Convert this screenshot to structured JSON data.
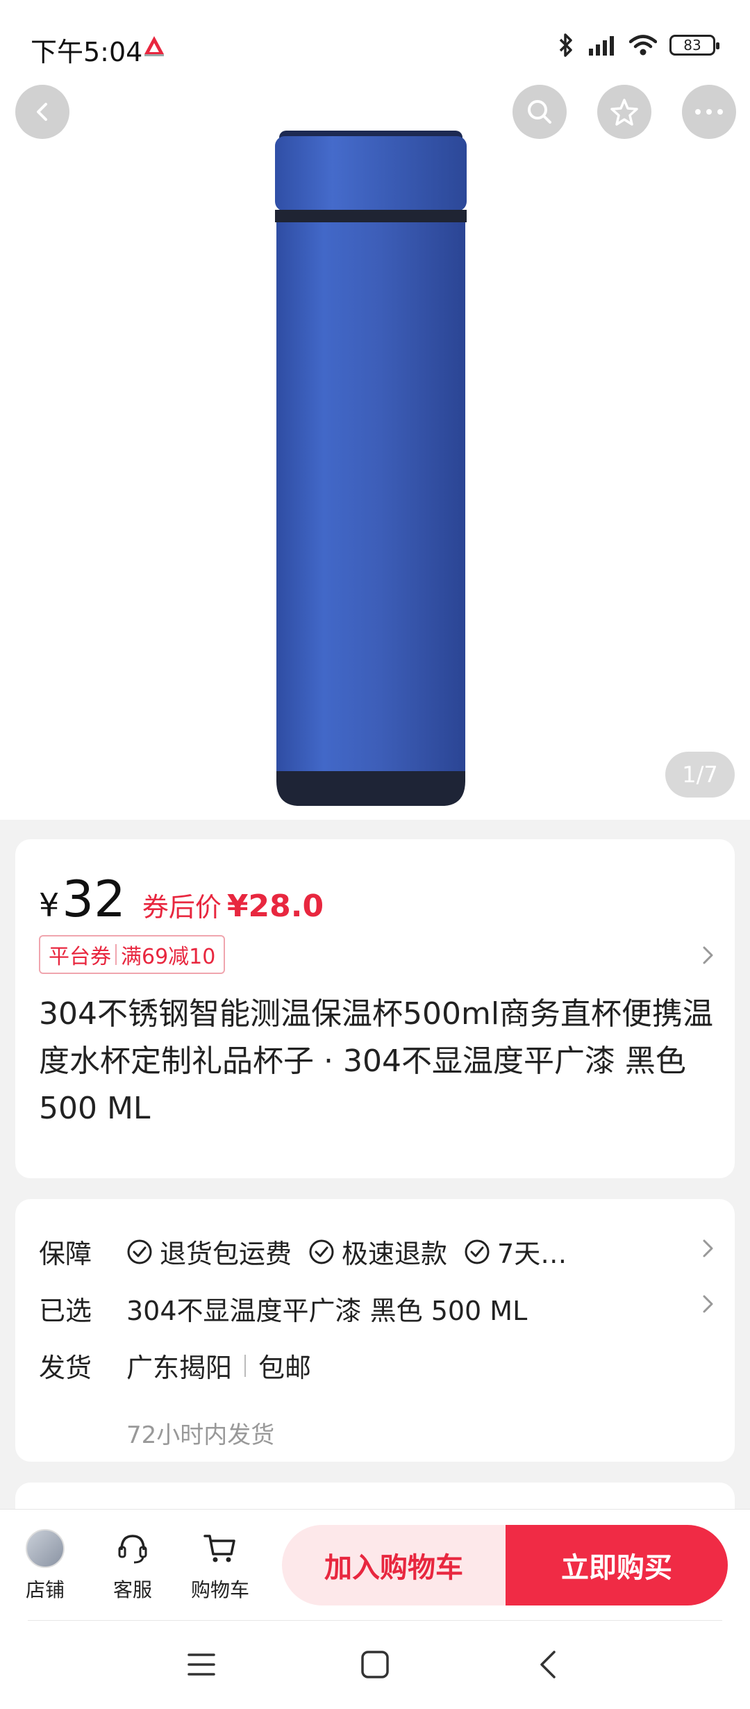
{
  "status_bar": {
    "time": "下午5:04",
    "battery": "83"
  },
  "gallery": {
    "counter": "1/7"
  },
  "product": {
    "currency": "¥",
    "price": "32",
    "after_coupon_label": "券后价",
    "after_coupon_price": "¥28.0",
    "coupon_tag": "平台券",
    "coupon_rule": "满69减10",
    "title": "304不锈钢智能测温保温杯500ml商务直杯便携温度水杯定制礼品杯子 · 304不显温度平广漆 黑色 500 ML"
  },
  "info": {
    "guarantee_label": "保障",
    "guarantees": [
      "退货包运费",
      "极速退款",
      "7天…"
    ],
    "selected_label": "已选",
    "selected_value": "304不显温度平广漆 黑色 500 ML",
    "shipping_label": "发货",
    "shipping_from": "广东揭阳",
    "shipping_fee": "包邮",
    "shipping_time": "72小时内发货"
  },
  "bottom": {
    "store": "店铺",
    "service": "客服",
    "cart": "购物车",
    "add_to_cart": "加入购物车",
    "buy_now": "立即购买"
  },
  "colors": {
    "accent": "#e8273f",
    "buy_button": "#f02b45",
    "cart_button_bg": "#fde8ea",
    "product_blue": "#3d5eb8"
  }
}
